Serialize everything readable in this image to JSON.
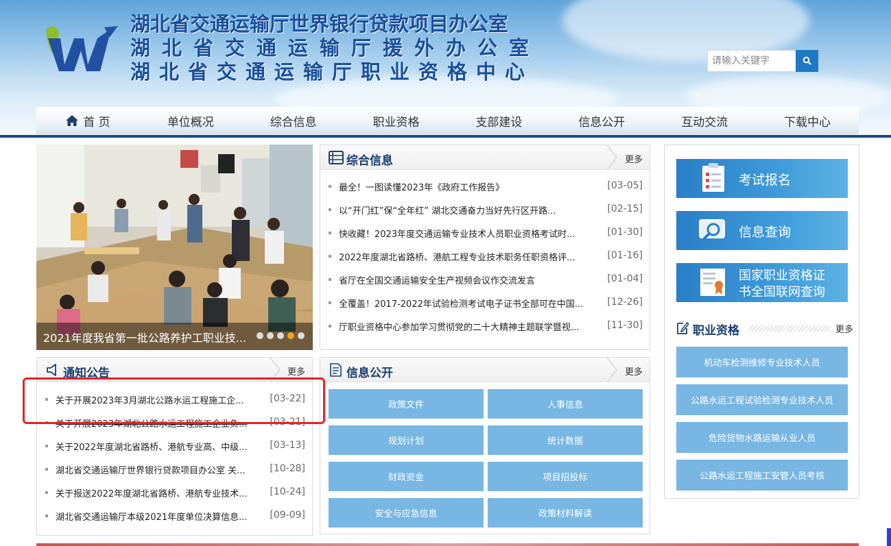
{
  "header": {
    "titles": [
      "湖北省交通运输厅世界银行贷款项目办公室",
      "湖北省交通运输厅援外办公室",
      "湖北省交通运输厅职业资格中心"
    ],
    "search_placeholder": "请输入关键字"
  },
  "nav": [
    "首 页",
    "单位概况",
    "综合信息",
    "职业资格",
    "支部建设",
    "信息公开",
    "互动交流",
    "下载中心"
  ],
  "carousel": {
    "caption": "2021年度我省第一批公路养护工职业技...",
    "dot_count": 5,
    "active_dot": 3
  },
  "zonghe": {
    "title": "综合信息",
    "more": "更多",
    "items": [
      {
        "title": "最全！一图读懂2023年《政府工作报告》",
        "date": "[03-05]"
      },
      {
        "title": "以“开门红”保“全年红” 湖北交通奋力当好先行区开路...",
        "date": "[02-15]"
      },
      {
        "title": "快收藏！2023年度交通运输专业技术人员职业资格考试时...",
        "date": "[01-30]"
      },
      {
        "title": "2022年度湖北省路桥、港航工程专业技术职务任职资格评...",
        "date": "[01-16]"
      },
      {
        "title": "省厅在全国交通运输安全生产视频会议作交流发言",
        "date": "[01-04]"
      },
      {
        "title": "全覆盖！2017-2022年试验检测考试电子证书全部可在中国...",
        "date": "[12-26]"
      },
      {
        "title": "厅职业资格中心参加学习贯彻党的二十大精神主题联学暨视...",
        "date": "[11-30]"
      }
    ]
  },
  "notice": {
    "title": "通知公告",
    "more": "更多",
    "items": [
      {
        "title": "关于开展2023年3月湖北公路水运工程施工企...",
        "date": "[03-22]"
      },
      {
        "title": "关于开展2023年湖北公路水运工程施工企业负...",
        "date": "[03-21]"
      },
      {
        "title": "关于2022年度湖北省路桥、港航专业高、中级...",
        "date": "[03-13]"
      },
      {
        "title": "湖北省交通运输厅世界银行贷款项目办公室 关...",
        "date": "[10-28]"
      },
      {
        "title": "关于报送2022年度湖北省路桥、港航专业技术...",
        "date": "[10-24]"
      },
      {
        "title": "湖北省交通运输厅本级2021年度单位决算信息...",
        "date": "[09-09]"
      }
    ]
  },
  "xinxi": {
    "title": "信息公开",
    "more": "更多",
    "buttons": [
      "政策文件",
      "人事信息",
      "规划计划",
      "统计数据",
      "财政资金",
      "项目招投标",
      "安全与应急信息",
      "政策材料解读"
    ]
  },
  "right": {
    "banners": [
      "考试报名",
      "信息查询",
      "国家职业资格证",
      "书全国联网查询"
    ],
    "zhiye_title": "职业资格",
    "zhiye_more": "更多",
    "zhiye_buttons": [
      "机动车检测维修专业技术人员",
      "公路水运工程试验检测专业技术人员",
      "危险货物水路运输从业人员",
      "公路水运工程施工安管人员考核"
    ]
  }
}
